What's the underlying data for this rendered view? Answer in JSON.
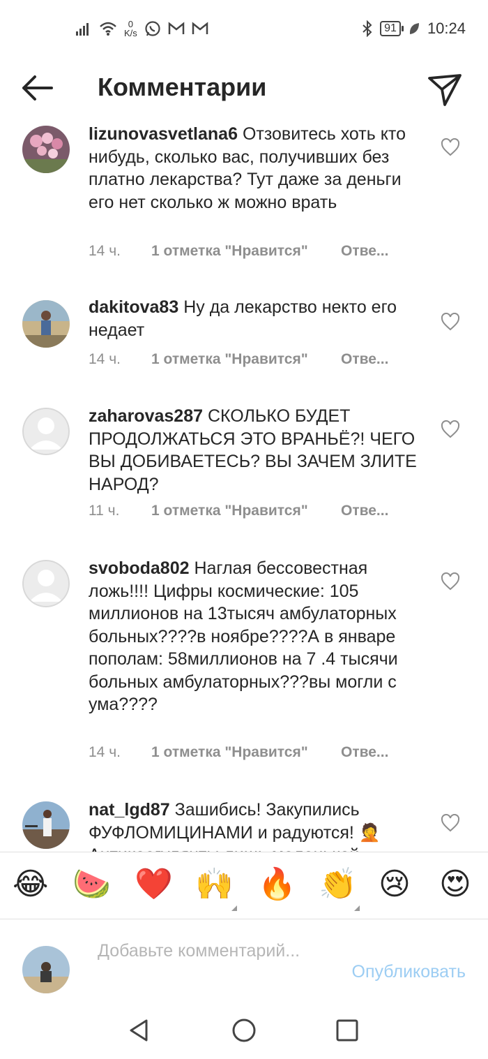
{
  "status_bar": {
    "speed_value": "0",
    "speed_unit": "K/s",
    "battery": "91",
    "time": "10:24",
    "icons": [
      "signal-icon",
      "wifi-icon",
      "whatsapp-icon",
      "gmail-icon",
      "gmail-icon",
      "bluetooth-icon",
      "battery-icon",
      "leaf-icon"
    ]
  },
  "header": {
    "title": "Комментарии"
  },
  "comments": [
    {
      "username": "lizunovasvetlana6",
      "text": "Отзовитесь хоть кто нибудь, сколько вас, получивших без платно лекарства? Тут даже за деньги его нет сколько ж можно врать",
      "time": "14 ч.",
      "likes": "1 отметка \"Нравится\"",
      "reply": "Отве..."
    },
    {
      "username": "dakitova83",
      "text": "Ну да лекарство некто его недает",
      "time": "14 ч.",
      "likes": "1 отметка \"Нравится\"",
      "reply": "Отве..."
    },
    {
      "username": "zaharovas287",
      "text": "СКОЛЬКО БУДЕТ ПРОДОЛЖАТЬСЯ ЭТО ВРАНЬЁ?! ЧЕГО ВЫ ДОБИВАЕТЕСЬ? ВЫ ЗАЧЕМ ЗЛИТЕ НАРОД?",
      "time": "11 ч.",
      "likes": "1 отметка \"Нравится\"",
      "reply": "Отве..."
    },
    {
      "username": "svoboda802",
      "text": "Наглая бессовестная ложь!!!! Цифры космические: 105 миллионов на 13тысяч амбулаторных больных????в ноябре????А в январе пополам: 58миллионов на 7 .4 тысячи больных амбулаторных???вы могли с ума????",
      "time": "14 ч.",
      "likes": "1 отметка \"Нравится\"",
      "reply": "Отве..."
    },
    {
      "username": "nat_lgd87",
      "text": "Зашибись! Закупились ФУФЛОМИЦИНАМИ и радуются! 🤦 Антикоагулянты лишь маленькой",
      "time": "",
      "likes": "",
      "reply": ""
    }
  ],
  "emoji_bar": [
    "😂",
    "🍉",
    "❤️",
    "🙌",
    "🔥",
    "👏",
    "😢",
    "😍"
  ],
  "compose": {
    "placeholder": "Добавьте комментарий...",
    "post_label": "Опубликовать"
  },
  "colors": {
    "text": "#262626",
    "secondary": "#8e8e8e",
    "post_disabled": "#9ccdf3"
  }
}
